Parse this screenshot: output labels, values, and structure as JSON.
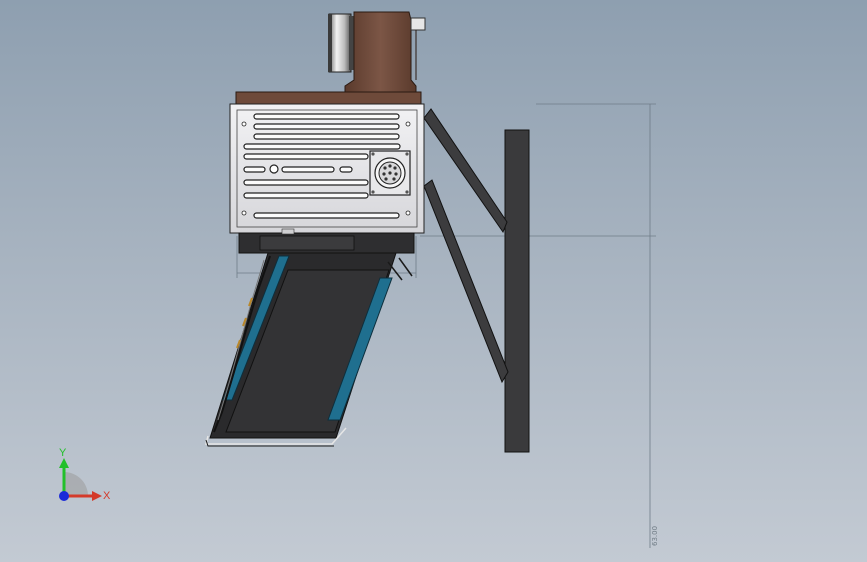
{
  "viewport": {
    "view": "front"
  },
  "triad": {
    "y_label": "Y",
    "x_label": "X",
    "colors": {
      "y_axis": "#22c02a",
      "x_axis": "#d43a2a",
      "z_axis": "#1a2ad8"
    }
  },
  "dimension": {
    "value_text": "63.00"
  },
  "model": {
    "parts": [
      "motor",
      "gearbox-housing",
      "controller-box",
      "connector",
      "mounting-bracket",
      "brace-arms",
      "conveyor-chute"
    ],
    "colors": {
      "housing": "#e4e4e6",
      "gearbox": "#6e4a3a",
      "bracket": "#3a3a3c",
      "chute": "#303032",
      "chute_stripe": "#1f6f8f"
    }
  }
}
